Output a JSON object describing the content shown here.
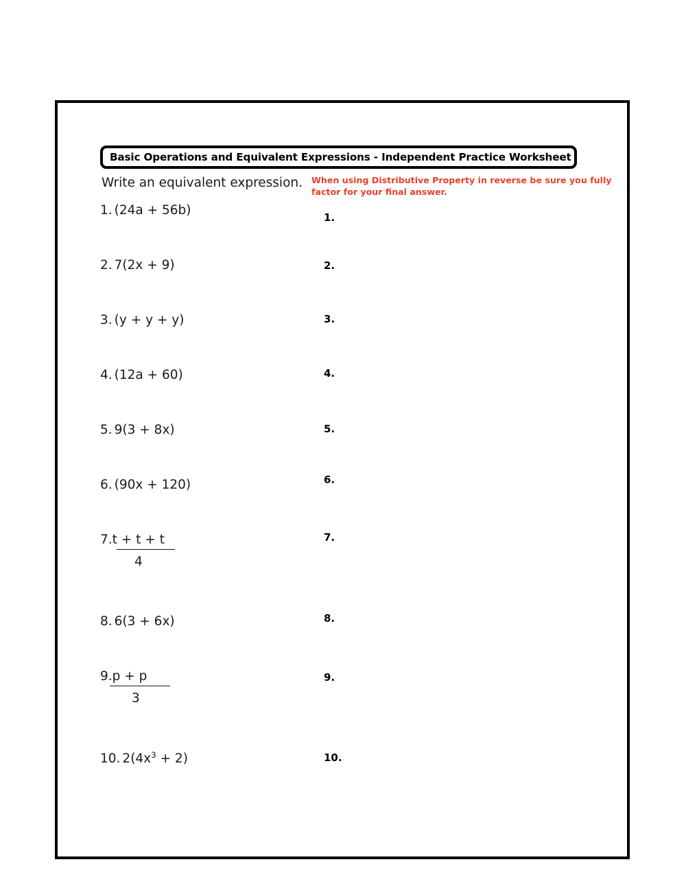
{
  "worksheet": {
    "title": "Basic Operations and Equivalent Expressions - Independent Practice Worksheet",
    "instruction": "Write an equivalent expression.",
    "note": "When using Distributive Property in reverse be sure you fully factor for your final answer.",
    "note_color": "#E8402A"
  },
  "problems": [
    {
      "number": "1.",
      "expression": "(24a + 56b)",
      "type": "inline"
    },
    {
      "number": "2.",
      "expression": "7(2x + 9)",
      "type": "inline"
    },
    {
      "number": "3.",
      "expression": "(y + y + y)",
      "type": "inline"
    },
    {
      "number": "4.",
      "expression": "(12a + 60)",
      "type": "inline"
    },
    {
      "number": "5.",
      "expression": "9(3 + 8x)",
      "type": "inline"
    },
    {
      "number": "6.",
      "expression": "(90x + 120)",
      "type": "inline"
    },
    {
      "number": "7.",
      "numerator": "t + t + t",
      "denominator": "4",
      "type": "fraction"
    },
    {
      "number": "8.",
      "expression": "6(3 + 6x)",
      "type": "inline"
    },
    {
      "number": "9.",
      "numerator": "p + p",
      "denominator": "3",
      "type": "fraction"
    },
    {
      "number": "10.",
      "expression_prefix": "2(4x",
      "exponent": "3",
      "expression_suffix": " + 2)",
      "type": "exponent"
    }
  ],
  "answers": [
    {
      "label": "1."
    },
    {
      "label": "2."
    },
    {
      "label": "3."
    },
    {
      "label": "4."
    },
    {
      "label": "5."
    },
    {
      "label": "6."
    },
    {
      "label": "7."
    },
    {
      "label": "8."
    },
    {
      "label": "9."
    },
    {
      "label": "10."
    }
  ]
}
